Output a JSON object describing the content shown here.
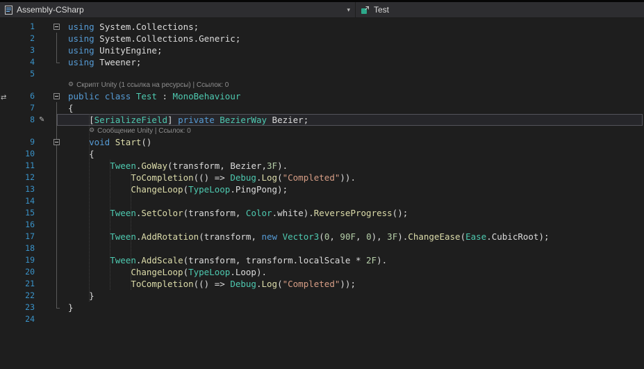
{
  "nav": {
    "project_label": "Assembly-CSharp",
    "type_label": "Test"
  },
  "icons": {
    "dropdown_chevron": "▾",
    "codelens_gear": "⚙",
    "edit_pencil": "✎",
    "margin_marker": "⇄"
  },
  "colors": {
    "editor_bg": "#1e1e1e",
    "navbar_bg": "#2d2d30",
    "keyword": "#569cd6",
    "type": "#4ec9b0",
    "method": "#dcdcaa",
    "string": "#d69d85",
    "number": "#b5cea8",
    "text": "#dcdcdc",
    "line_number": "#3a93c9",
    "codelens": "#8f8f8f",
    "highlight_border": "#53535a"
  },
  "editor": {
    "lines": [
      {
        "n": 1,
        "fold": true,
        "tokens": [
          [
            "kw",
            "using"
          ],
          [
            "pl",
            " System.Collections;"
          ]
        ]
      },
      {
        "n": 2,
        "out": "v",
        "tokens": [
          [
            "kw",
            "using"
          ],
          [
            "pl",
            " System.Collections.Generic;"
          ]
        ]
      },
      {
        "n": 3,
        "out": "v",
        "tokens": [
          [
            "kw",
            "using"
          ],
          [
            "pl",
            " UnityEngine;"
          ]
        ]
      },
      {
        "n": 4,
        "out": "vend",
        "tokens": [
          [
            "kw",
            "using"
          ],
          [
            "pl",
            " Tweener;"
          ]
        ]
      },
      {
        "n": 5,
        "tokens": []
      },
      {
        "n": 6,
        "fold": true,
        "marginIcon": true,
        "lens": {
          "text": "Скрипт Unity (1 ссылка на ресурсы) | Ссылок: 0",
          "indent": 0
        },
        "tokens": [
          [
            "kw",
            "public"
          ],
          [
            "pl",
            " "
          ],
          [
            "kw",
            "class"
          ],
          [
            "pl",
            " "
          ],
          [
            "ty",
            "Test"
          ],
          [
            "pl",
            " : "
          ],
          [
            "ty",
            "MonoBehaviour"
          ]
        ]
      },
      {
        "n": 7,
        "out": "v",
        "tokens": [
          [
            "pl",
            "{"
          ]
        ]
      },
      {
        "n": 8,
        "out": "v",
        "hl": true,
        "adorn": true,
        "tokens": [
          [
            "pl",
            "    ["
          ],
          [
            "ty",
            "SerializeField"
          ],
          [
            "pl",
            "] "
          ],
          [
            "kw",
            "private"
          ],
          [
            "pl",
            " "
          ],
          [
            "ty",
            "BezierWay"
          ],
          [
            "pl",
            " Bezier;"
          ]
        ]
      },
      {
        "n": 9,
        "out": "v",
        "fold": true,
        "lens": {
          "text": "Сообщение Unity | Ссылок: 0",
          "indent": 4,
          "out": "v"
        },
        "tokens": [
          [
            "pl",
            "    "
          ],
          [
            "kw",
            "void"
          ],
          [
            "pl",
            " "
          ],
          [
            "me",
            "Start"
          ],
          [
            "pl",
            "()"
          ]
        ]
      },
      {
        "n": 10,
        "out": "v",
        "tokens": [
          [
            "pl",
            "    {"
          ]
        ]
      },
      {
        "n": 11,
        "out": "v",
        "tokens": [
          [
            "pl",
            "        "
          ],
          [
            "ty",
            "Tween"
          ],
          [
            "pl",
            "."
          ],
          [
            "me",
            "GoWay"
          ],
          [
            "pl",
            "(transform, Bezier,"
          ],
          [
            "nu",
            "3F"
          ],
          [
            "pl",
            ")."
          ]
        ]
      },
      {
        "n": 12,
        "out": "v",
        "tokens": [
          [
            "pl",
            "            "
          ],
          [
            "me",
            "ToCompletion"
          ],
          [
            "pl",
            "(() => "
          ],
          [
            "ty",
            "Debug"
          ],
          [
            "pl",
            "."
          ],
          [
            "me",
            "Log"
          ],
          [
            "pl",
            "("
          ],
          [
            "st",
            "\"Completed\""
          ],
          [
            "pl",
            "))."
          ]
        ]
      },
      {
        "n": 13,
        "out": "v",
        "tokens": [
          [
            "pl",
            "            "
          ],
          [
            "me",
            "ChangeLoop"
          ],
          [
            "pl",
            "("
          ],
          [
            "ty",
            "TypeLoop"
          ],
          [
            "pl",
            ".PingPong);"
          ]
        ]
      },
      {
        "n": 14,
        "out": "v",
        "tokens": []
      },
      {
        "n": 15,
        "out": "v",
        "tokens": [
          [
            "pl",
            "        "
          ],
          [
            "ty",
            "Tween"
          ],
          [
            "pl",
            "."
          ],
          [
            "me",
            "SetColor"
          ],
          [
            "pl",
            "(transform, "
          ],
          [
            "ty",
            "Color"
          ],
          [
            "pl",
            ".white)."
          ],
          [
            "me",
            "ReverseProgress"
          ],
          [
            "pl",
            "();"
          ]
        ]
      },
      {
        "n": 16,
        "out": "v",
        "tokens": []
      },
      {
        "n": 17,
        "out": "v",
        "tokens": [
          [
            "pl",
            "        "
          ],
          [
            "ty",
            "Tween"
          ],
          [
            "pl",
            "."
          ],
          [
            "me",
            "AddRotation"
          ],
          [
            "pl",
            "(transform, "
          ],
          [
            "kw",
            "new"
          ],
          [
            "pl",
            " "
          ],
          [
            "ty",
            "Vector3"
          ],
          [
            "pl",
            "("
          ],
          [
            "nu",
            "0"
          ],
          [
            "pl",
            ", "
          ],
          [
            "nu",
            "90F"
          ],
          [
            "pl",
            ", "
          ],
          [
            "nu",
            "0"
          ],
          [
            "pl",
            "), "
          ],
          [
            "nu",
            "3F"
          ],
          [
            "pl",
            ")."
          ],
          [
            "me",
            "ChangeEase"
          ],
          [
            "pl",
            "("
          ],
          [
            "ty",
            "Ease"
          ],
          [
            "pl",
            ".CubicRoot);"
          ]
        ]
      },
      {
        "n": 18,
        "out": "v",
        "tokens": []
      },
      {
        "n": 19,
        "out": "v",
        "tokens": [
          [
            "pl",
            "        "
          ],
          [
            "ty",
            "Tween"
          ],
          [
            "pl",
            "."
          ],
          [
            "me",
            "AddScale"
          ],
          [
            "pl",
            "(transform, transform.localScale * "
          ],
          [
            "nu",
            "2F"
          ],
          [
            "pl",
            ")."
          ]
        ]
      },
      {
        "n": 20,
        "out": "v",
        "tokens": [
          [
            "pl",
            "            "
          ],
          [
            "me",
            "ChangeLoop"
          ],
          [
            "pl",
            "("
          ],
          [
            "ty",
            "TypeLoop"
          ],
          [
            "pl",
            ".Loop)."
          ]
        ]
      },
      {
        "n": 21,
        "out": "v",
        "tokens": [
          [
            "pl",
            "            "
          ],
          [
            "me",
            "ToCompletion"
          ],
          [
            "pl",
            "(() => "
          ],
          [
            "ty",
            "Debug"
          ],
          [
            "pl",
            "."
          ],
          [
            "me",
            "Log"
          ],
          [
            "pl",
            "("
          ],
          [
            "st",
            "\"Completed\""
          ],
          [
            "pl",
            "));"
          ]
        ]
      },
      {
        "n": 22,
        "out": "v",
        "tokens": [
          [
            "pl",
            "    }"
          ]
        ]
      },
      {
        "n": 23,
        "out": "vend",
        "tokens": [
          [
            "pl",
            "}"
          ]
        ]
      },
      {
        "n": 24,
        "tokens": []
      }
    ]
  }
}
